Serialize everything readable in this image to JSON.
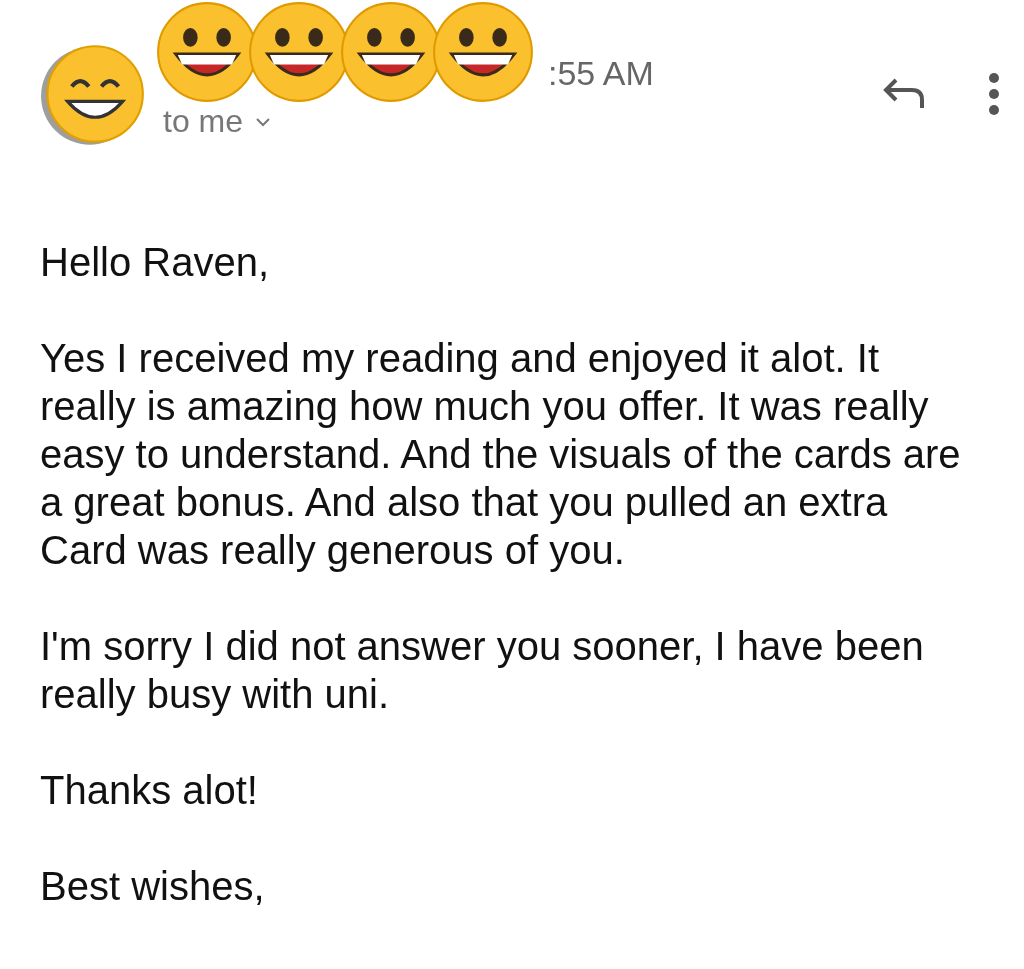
{
  "header": {
    "time": ":55 AM",
    "recipient": "to me"
  },
  "body": [
    {
      "lines": [
        "Hello Raven,"
      ]
    },
    {
      "lines": [
        "Yes I received my reading and enjoyed it alot. It",
        "really is amazing how much you offer. It was really",
        "easy to understand. And the visuals of the cards are",
        "a great bonus. And also that you pulled an extra",
        "Card was really generous of you."
      ]
    },
    {
      "lines": [
        "I'm sorry I did not answer you sooner, I have been",
        "really busy with uni."
      ]
    },
    {
      "lines": [
        "Thanks alot!"
      ]
    },
    {
      "lines": [
        "Best wishes,"
      ]
    }
  ]
}
